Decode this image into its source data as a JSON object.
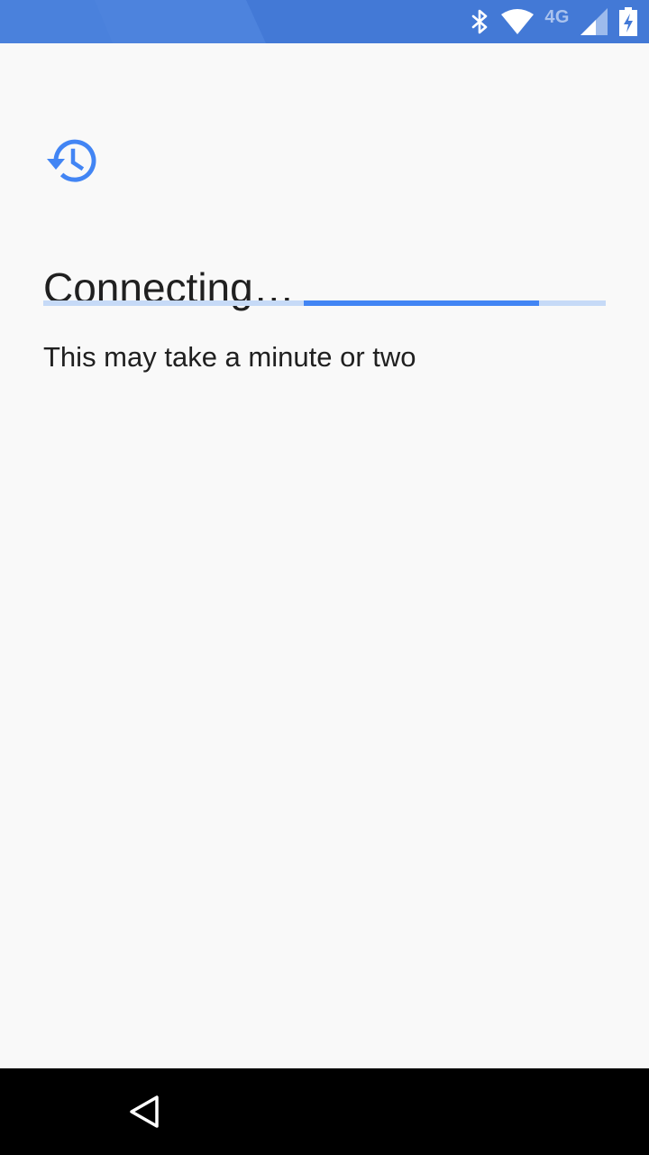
{
  "status_bar": {
    "background_color": "#4379d6",
    "icons": [
      "bluetooth-icon",
      "wifi-icon",
      "cell-signal-icon",
      "battery-charging-icon"
    ],
    "network_label": "4G"
  },
  "main": {
    "icon": "history-icon",
    "accent_color": "#4285f4",
    "title": "Connecting…",
    "progress": {
      "track_color": "#c6daf7",
      "fill_color": "#4285f4",
      "indeterminate": true
    },
    "subtitle": "This may take a minute or two"
  },
  "nav_bar": {
    "background_color": "#000000",
    "buttons": [
      "back-icon"
    ]
  }
}
